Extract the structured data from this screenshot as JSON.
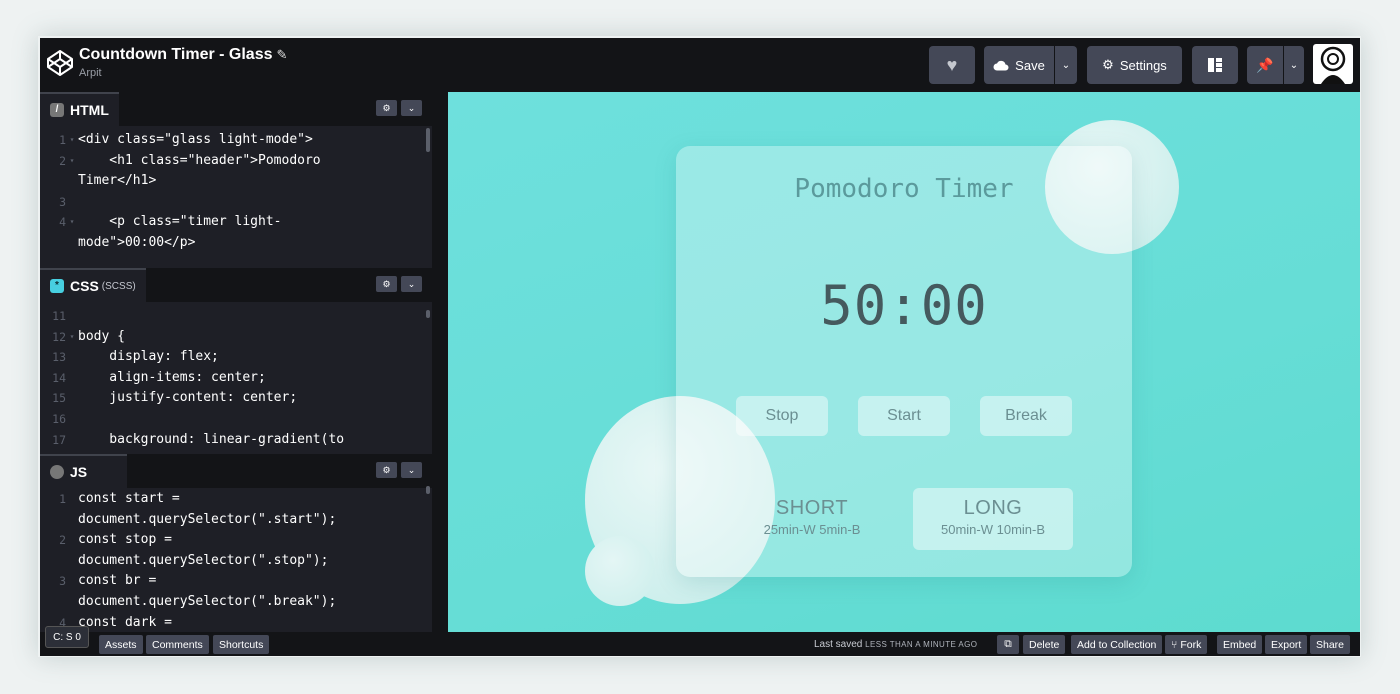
{
  "header": {
    "title": "Countdown Timer - Glass",
    "author": "Arpit",
    "save_label": "Save",
    "settings_label": "Settings"
  },
  "html_pane": {
    "label": "HTML",
    "lines": [
      {
        "n": "1",
        "fold": true,
        "text": "<div class=\"glass light-mode\">"
      },
      {
        "n": "2",
        "fold": true,
        "text": "    <h1 class=\"header\">Pomodoro"
      },
      {
        "n": "",
        "fold": false,
        "text": "Timer</h1>"
      },
      {
        "n": "3",
        "fold": false,
        "text": ""
      },
      {
        "n": "4",
        "fold": true,
        "text": "    <p class=\"timer light-"
      },
      {
        "n": "",
        "fold": false,
        "text": "mode\">00:00</p>"
      }
    ]
  },
  "css_pane": {
    "label": "CSS",
    "sub": "(SCSS)",
    "lines": [
      {
        "n": "11",
        "fold": false,
        "text": ""
      },
      {
        "n": "12",
        "fold": true,
        "text": "body {"
      },
      {
        "n": "13",
        "fold": false,
        "text": "    display: flex;"
      },
      {
        "n": "14",
        "fold": false,
        "text": "    align-items: center;"
      },
      {
        "n": "15",
        "fold": false,
        "text": "    justify-content: center;"
      },
      {
        "n": "16",
        "fold": false,
        "text": ""
      },
      {
        "n": "17",
        "fold": false,
        "text": "    background: linear-gradient(to"
      }
    ]
  },
  "js_pane": {
    "label": "JS",
    "lines": [
      {
        "n": "1",
        "fold": false,
        "text": "const start ="
      },
      {
        "n": "",
        "fold": false,
        "text": "document.querySelector(\".start\");"
      },
      {
        "n": "2",
        "fold": false,
        "text": "const stop ="
      },
      {
        "n": "",
        "fold": false,
        "text": "document.querySelector(\".stop\");"
      },
      {
        "n": "3",
        "fold": false,
        "text": "const br ="
      },
      {
        "n": "",
        "fold": false,
        "text": "document.querySelector(\".break\");"
      },
      {
        "n": "4",
        "fold": false,
        "text": "const dark ="
      }
    ]
  },
  "preview": {
    "title": "Pomodoro Timer",
    "timer": "50:00",
    "buttons": {
      "stop": "Stop",
      "start": "Start",
      "break": "Break"
    },
    "modes": [
      {
        "label": "SHORT",
        "detail": "25min-W 5min-B",
        "active": false
      },
      {
        "label": "LONG",
        "detail": "50min-W 10min-B",
        "active": true
      }
    ]
  },
  "footer": {
    "console": "C: S 0",
    "left_buttons": [
      "Assets",
      "Comments",
      "Shortcuts"
    ],
    "saved_prefix": "Last saved",
    "saved_when": "LESS THAN A MINUTE AGO",
    "right_buttons": [
      "Delete",
      "Add to Collection",
      "Fork",
      "Embed",
      "Export",
      "Share"
    ]
  },
  "colors": {
    "preview_bg": "#66ddd6",
    "chrome_dark": "#131417",
    "button_gray": "#444857"
  }
}
